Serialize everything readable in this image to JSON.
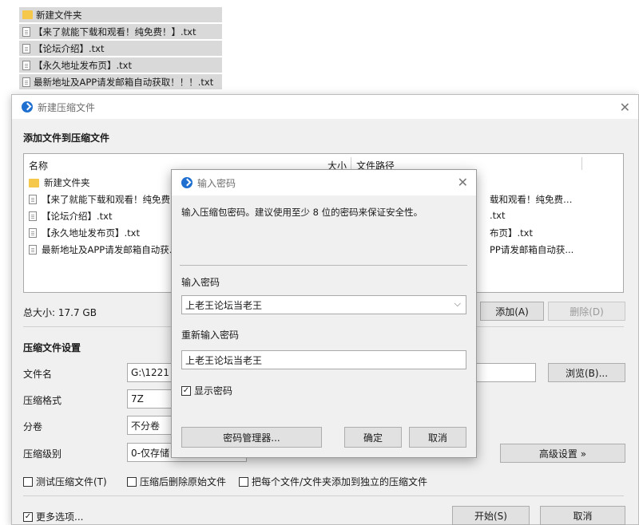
{
  "explorer": {
    "items": [
      {
        "icon": "folder-icon",
        "name": "新建文件夹"
      },
      {
        "icon": "text-file-icon",
        "name": "【来了就能下载和观看！纯免费！】.txt"
      },
      {
        "icon": "text-file-icon",
        "name": "【论坛介绍】.txt"
      },
      {
        "icon": "text-file-icon",
        "name": "【永久地址发布页】.txt"
      },
      {
        "icon": "text-file-icon",
        "name": "最新地址及APP请发邮箱自动获取！！！.txt"
      }
    ]
  },
  "main_dialog": {
    "title": "新建压缩文件",
    "section_add": "添加文件到压缩文件",
    "columns": {
      "name": "名称",
      "size": "大小",
      "path": "文件路径"
    },
    "files": [
      {
        "icon": "folder-icon",
        "name": "新建文件夹",
        "path": ""
      },
      {
        "icon": "text-file-icon",
        "name": "【来了就能下载和观看！纯免费…",
        "path": "载和观看！纯免费…"
      },
      {
        "icon": "text-file-icon",
        "name": "【论坛介绍】.txt",
        "path": ".txt"
      },
      {
        "icon": "text-file-icon",
        "name": "【永久地址发布页】.txt",
        "path": "布页】.txt"
      },
      {
        "icon": "text-file-icon",
        "name": "最新地址及APP请发邮箱自动获…",
        "path": "PP请发邮箱自动获..."
      }
    ],
    "total_size": "总大小: 17.7 GB",
    "add_button": "添加(A)",
    "delete_button": "删除(D)",
    "settings_heading": "压缩文件设置",
    "filename_label": "文件名",
    "filename_value": "G:\\1221 (",
    "browse_button": "浏览(B)...",
    "format_label": "压缩格式",
    "format_value": "7Z",
    "split_label": "分卷",
    "split_value": "不分卷",
    "level_label": "压缩级别",
    "level_value": "0-仅存储",
    "advanced_button": "高级设置 »",
    "test_label": "测试压缩文件(T)",
    "delete_after_label": "压缩后删除原始文件",
    "separate_label": "把每个文件/文件夹添加到独立的压缩文件",
    "more_options_label": "更多选项...",
    "start_button": "开始(S)",
    "cancel_button": "取消"
  },
  "password_dialog": {
    "title": "输入密码",
    "description": "输入压缩包密码。建议使用至少 8 位的密码来保证安全性。",
    "enter_label": "输入密码",
    "enter_value": "上老王论坛当老王",
    "reenter_label": "重新输入密码",
    "reenter_value": "上老王论坛当老王",
    "show_password_label": "显示密码",
    "manager_button": "密码管理器...",
    "ok_button": "确定",
    "cancel_button": "取消"
  }
}
